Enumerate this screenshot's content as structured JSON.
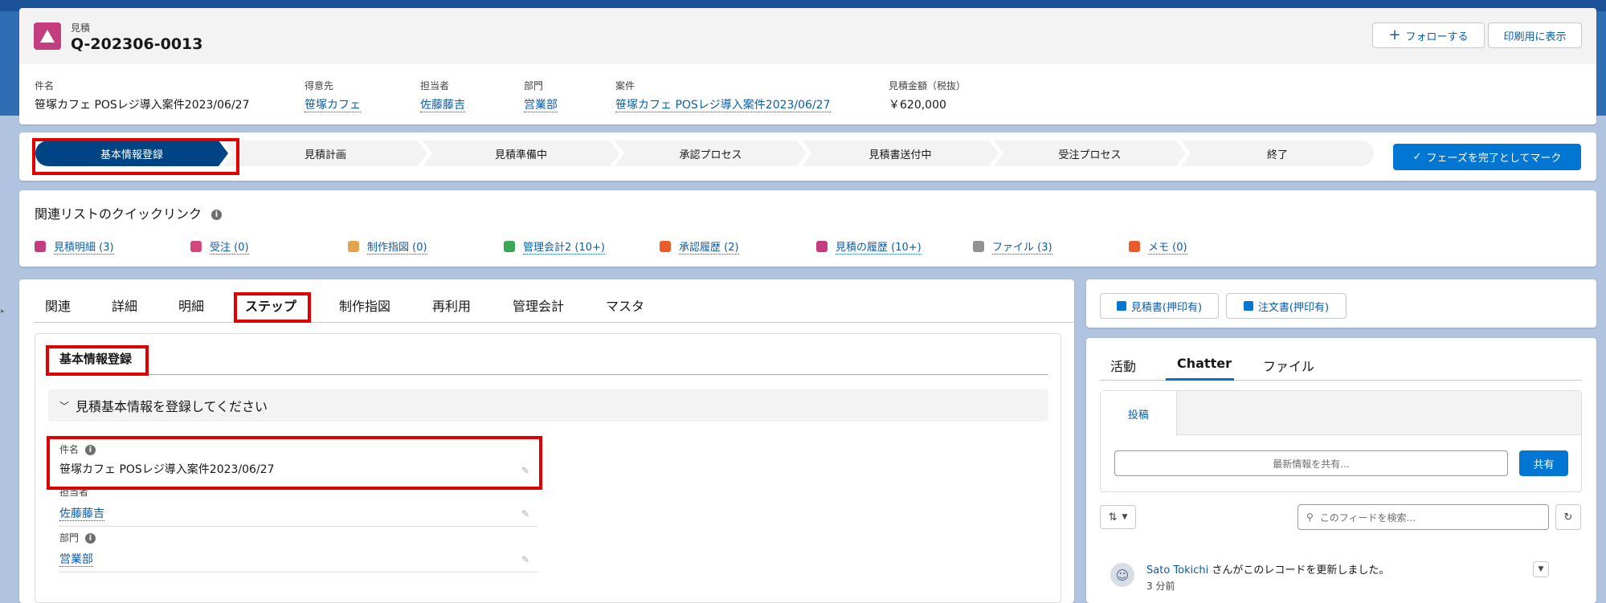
{
  "record": {
    "object_type": "見積",
    "name": "Q-202306-0013",
    "follow_label": "フォローする",
    "print_label": "印刷用に表示"
  },
  "highlights": [
    {
      "label": "件名",
      "value": "笹塚カフェ POSレジ導入案件2023/06/27",
      "link": false
    },
    {
      "label": "得意先",
      "value": "笹塚カフェ",
      "link": true
    },
    {
      "label": "担当者",
      "value": "佐藤藤吉",
      "link": true
    },
    {
      "label": "部門",
      "value": "営業部",
      "link": true
    },
    {
      "label": "案件",
      "value": "笹塚カフェ POSレジ導入案件2023/06/27",
      "link": true
    },
    {
      "label": "見積金額（税抜）",
      "value": "￥620,000",
      "link": false
    }
  ],
  "path": {
    "steps": [
      "基本情報登録",
      "見積計画",
      "見積準備中",
      "承認プロセス",
      "見積書送付中",
      "受注プロセス",
      "終了"
    ],
    "active_index": 0,
    "complete_label": "フェーズを完了としてマーク"
  },
  "quick_links": {
    "title": "関連リストのクイックリンク",
    "items": [
      {
        "label": "見積明細 (3)",
        "color": "#c23e7e"
      },
      {
        "label": "受注 (0)",
        "color": "#d4477d"
      },
      {
        "label": "制作指図 (0)",
        "color": "#e3a34f"
      },
      {
        "label": "管理会計2 (10+)",
        "color": "#3ba755"
      },
      {
        "label": "承認履歴 (2)",
        "color": "#ea5b2a"
      },
      {
        "label": "見積の履歴 (10+)",
        "color": "#c23e7e"
      },
      {
        "label": "ファイル (3)",
        "color": "#939393"
      },
      {
        "label": "メモ (0)",
        "color": "#ea5b2a"
      }
    ]
  },
  "main_tabs": {
    "items": [
      "関連",
      "詳細",
      "明細",
      "ステップ",
      "制作指図",
      "再利用",
      "管理会計",
      "マスタ"
    ],
    "active_index": 3
  },
  "step_panel": {
    "title": "基本情報登録",
    "section": "見積基本情報を登録してください",
    "fields": [
      {
        "label": "件名",
        "value": "笹塚カフェ POSレジ導入案件2023/06/27",
        "info": true,
        "link": false
      },
      {
        "label": "担当者",
        "value": "佐藤藤吉",
        "info": false,
        "link": true
      },
      {
        "label": "部門",
        "value": "営業部",
        "info": true,
        "link": true
      }
    ]
  },
  "docs": {
    "quote_btn": "見積書(押印有)",
    "order_btn": "注文書(押印有)"
  },
  "feed": {
    "tabs": [
      "活動",
      "Chatter",
      "ファイル"
    ],
    "active_index": 1,
    "post_tab": "投稿",
    "share_placeholder": "最新情報を共有...",
    "share_btn": "共有",
    "search_placeholder": "このフィードを検索...",
    "item": {
      "user": "Sato Tokichi",
      "text": "さんがこのレコードを更新しました。",
      "time": "3 分前"
    }
  }
}
